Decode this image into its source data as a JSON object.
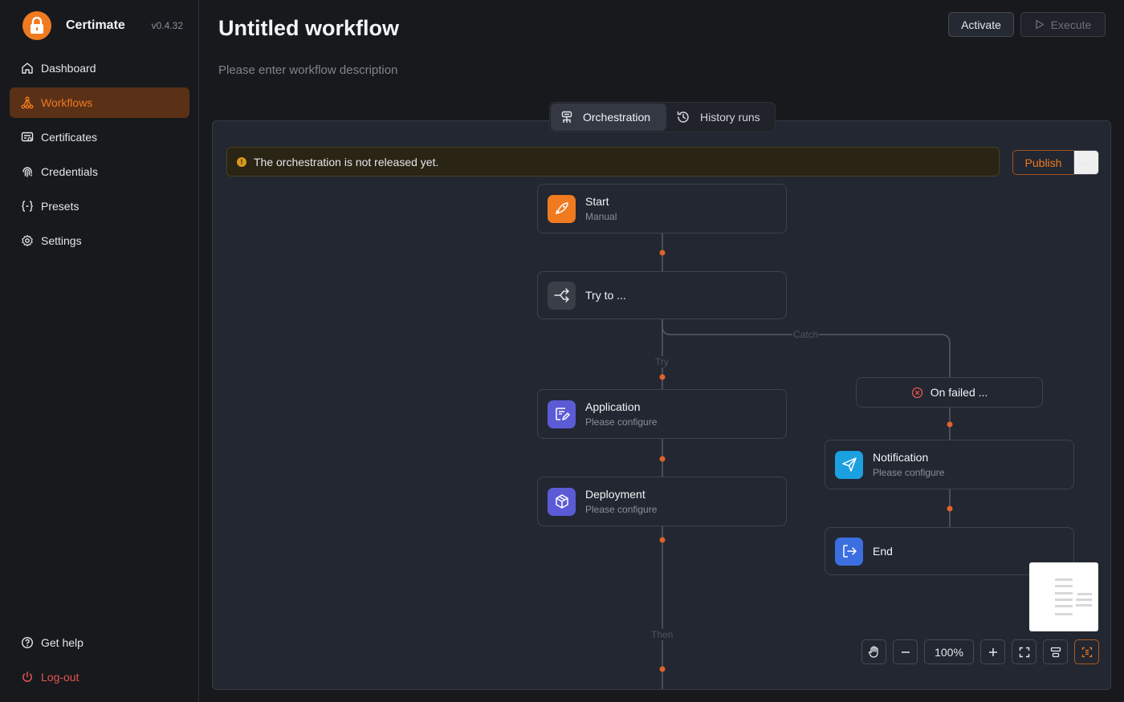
{
  "app": {
    "name": "Certimate",
    "version": "v0.4.32"
  },
  "sidebar": {
    "items": [
      {
        "label": "Dashboard",
        "icon": "home-icon"
      },
      {
        "label": "Workflows",
        "icon": "workflow-icon",
        "active": true
      },
      {
        "label": "Certificates",
        "icon": "certificate-icon"
      },
      {
        "label": "Credentials",
        "icon": "fingerprint-icon"
      },
      {
        "label": "Presets",
        "icon": "braces-icon"
      },
      {
        "label": "Settings",
        "icon": "gear-icon"
      }
    ],
    "bottom": [
      {
        "label": "Get help",
        "icon": "help-icon"
      },
      {
        "label": "Log-out",
        "icon": "power-icon"
      }
    ]
  },
  "header": {
    "title": "Untitled workflow",
    "description_placeholder": "Please enter workflow description",
    "activate_label": "Activate",
    "execute_label": "Execute"
  },
  "tabs": [
    {
      "label": "Orchestration",
      "active": true
    },
    {
      "label": "History runs"
    }
  ],
  "alert": {
    "text": "The orchestration is not released yet.",
    "icon": "!"
  },
  "actions": {
    "publish_label": "Publish",
    "more_label": "···"
  },
  "flow": {
    "nodes": {
      "start": {
        "title": "Start",
        "subtitle": "Manual"
      },
      "try": {
        "title": "Try to ..."
      },
      "application": {
        "title": "Application",
        "subtitle": "Please configure"
      },
      "deployment": {
        "title": "Deployment",
        "subtitle": "Please configure"
      },
      "on_failed": {
        "title": "On failed ..."
      },
      "notification": {
        "title": "Notification",
        "subtitle": "Please configure"
      },
      "end": {
        "title": "End"
      }
    },
    "edge_labels": {
      "catch": "Catch",
      "try": "Try",
      "then": "Then"
    }
  },
  "controls": {
    "zoom": "100%"
  },
  "colors": {
    "accent": "#f07a1f",
    "start_icon_bg": "#f07a1f",
    "application_icon_bg": "#5b5bd6",
    "deployment_icon_bg": "#5b5bd6",
    "notification_icon_bg": "#1ba0e0",
    "end_icon_bg": "#3b6fe0",
    "error": "#e4554f"
  }
}
